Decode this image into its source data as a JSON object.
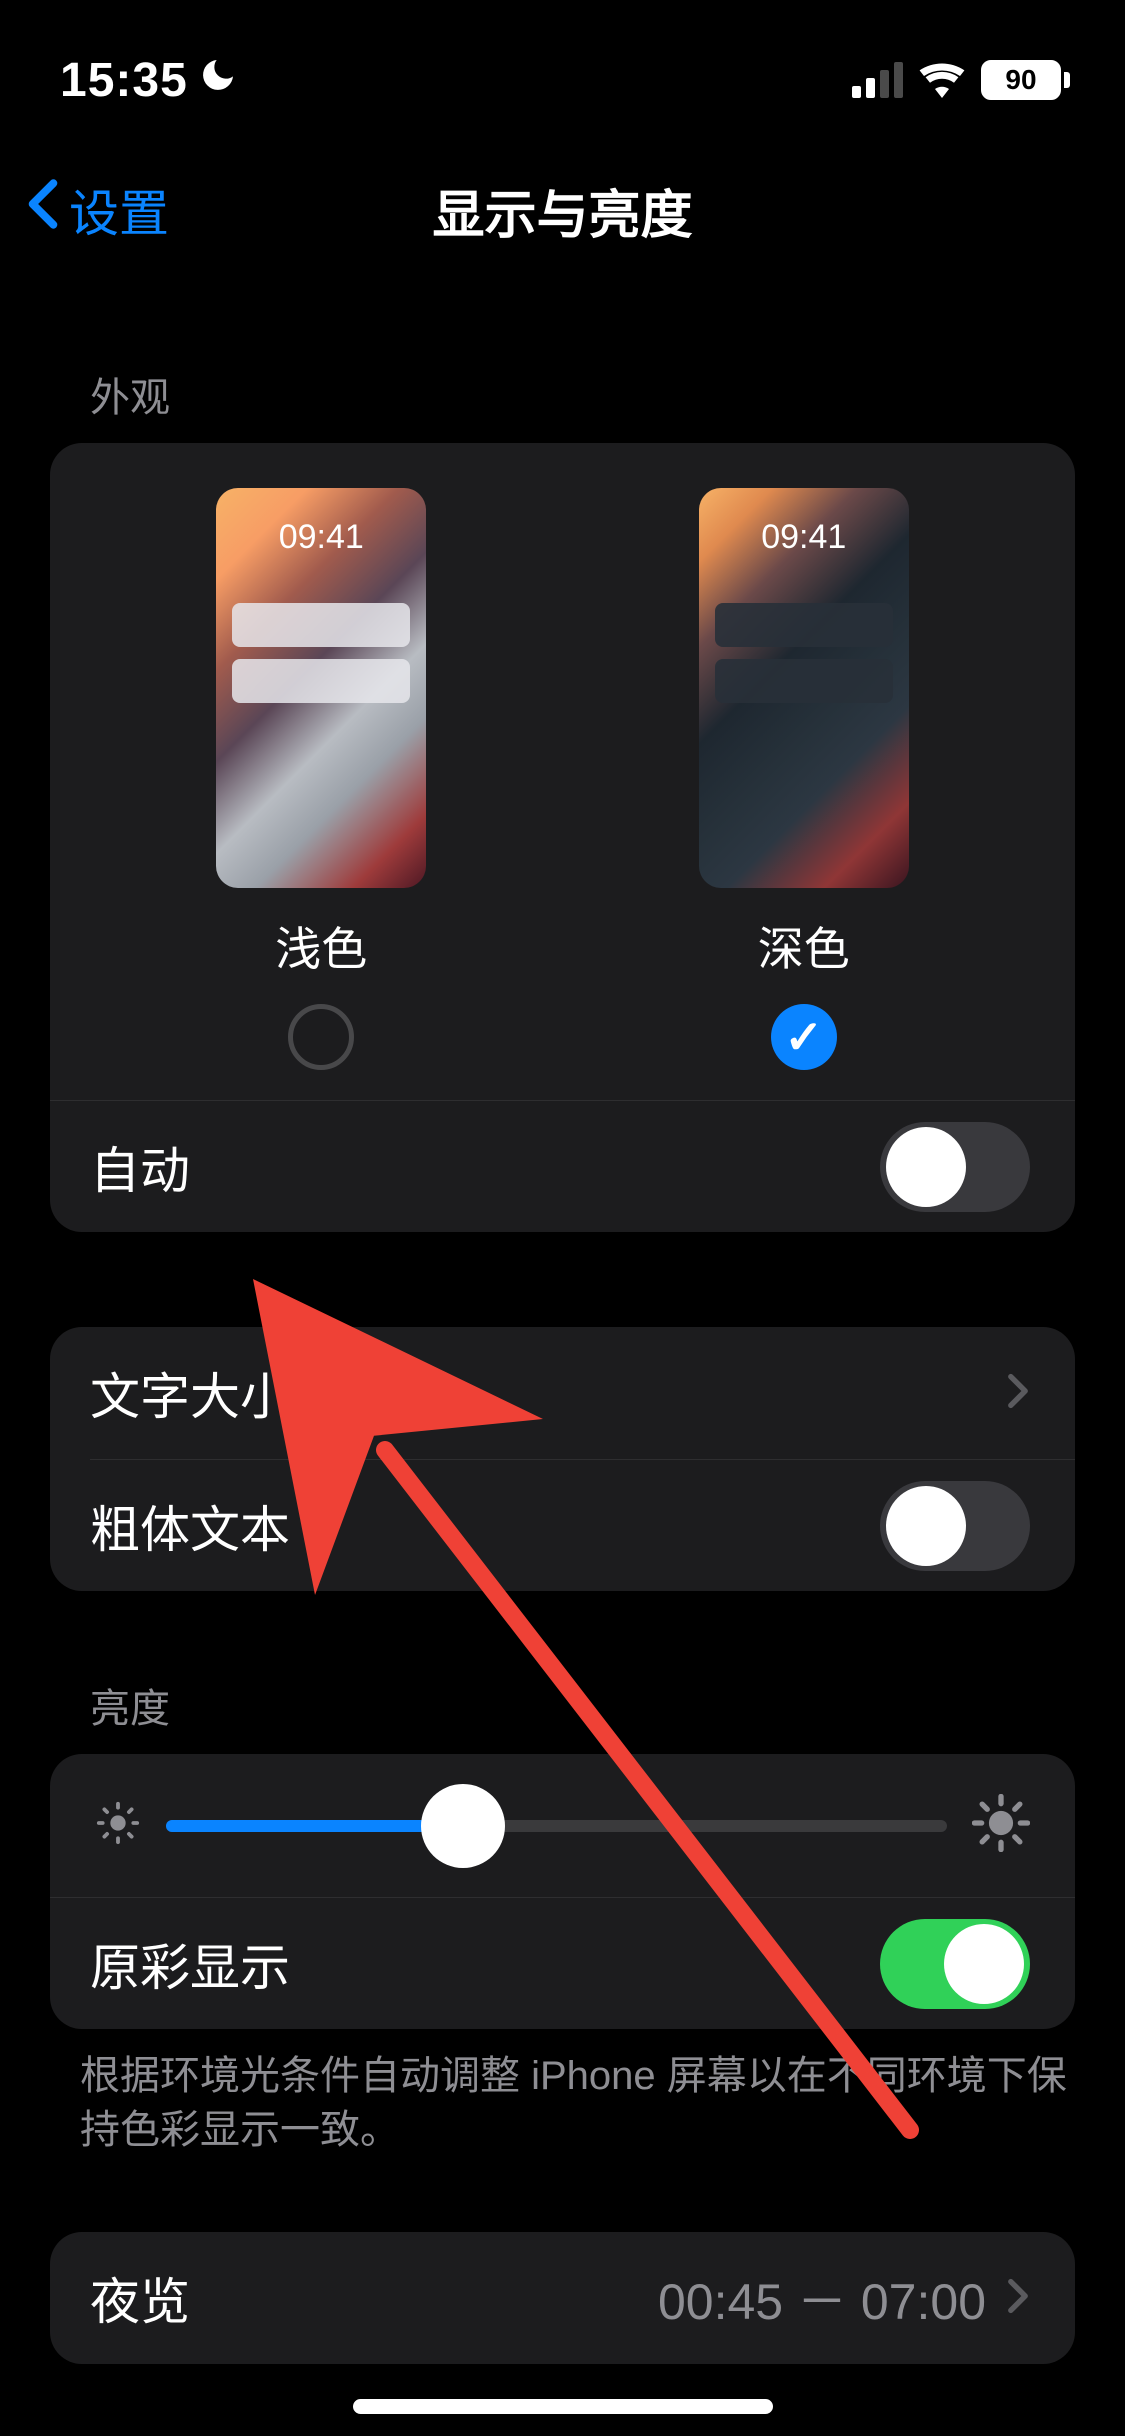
{
  "status": {
    "time": "15:35",
    "battery_pct": "90"
  },
  "nav": {
    "back_label": "设置",
    "title": "显示与亮度"
  },
  "appearance": {
    "header": "外观",
    "preview_time": "09:41",
    "light_label": "浅色",
    "dark_label": "深色",
    "auto_label": "自动",
    "auto_on": false,
    "selected": "dark"
  },
  "text": {
    "size_label": "文字大小",
    "bold_label": "粗体文本",
    "bold_on": false
  },
  "brightness": {
    "header": "亮度",
    "value_pct": 38,
    "truetone_label": "原彩显示",
    "truetone_on": true,
    "footer": "根据环境光条件自动调整 iPhone 屏幕以在不同环境下保持色彩显示一致。"
  },
  "nightshift": {
    "label": "夜览",
    "detail": "00:45 － 07:00"
  }
}
